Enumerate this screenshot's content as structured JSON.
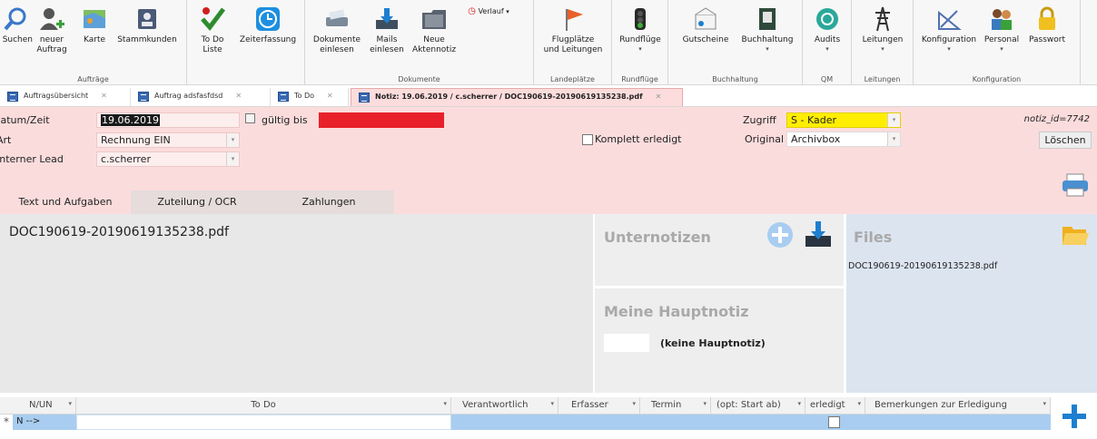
{
  "ribbon": {
    "groups": {
      "auftraege": "Aufträge",
      "dokumente": "Dokumente",
      "landeplaetze": "Landeplätze",
      "rundfluege": "Rundflüge",
      "buchhaltung": "Buchhaltung",
      "qm": "QM",
      "leitungen": "Leitungen",
      "konfiguration": "Konfiguration"
    },
    "buttons": {
      "suchen": "Suchen",
      "neuer_auftrag": "neuer\nAuftrag",
      "karte": "Karte",
      "stammkunden": "Stammkunden",
      "todo_liste": "To Do\nListe",
      "zeiterfassung": "Zeiterfassung",
      "verlauf": "Verlauf",
      "dokumente_einlesen": "Dokumente\neinlesen",
      "mails_einlesen": "Mails\neinlesen",
      "neue_aktennotiz": "Neue\nAktennotiz",
      "flugplaetze": "Flugplätze\nund Leitungen",
      "rundfluege": "Rundflüge",
      "gutscheine": "Gutscheine",
      "buchhaltung": "Buchhaltung",
      "audits": "Audits",
      "leitungen": "Leitungen",
      "konfiguration": "Konfiguration",
      "personal": "Personal",
      "passwort": "Passwort"
    }
  },
  "tabs": [
    {
      "label": "Auftragsübersicht"
    },
    {
      "label": "Auftrag adsfasfdsd"
    },
    {
      "label": "To Do"
    },
    {
      "label": "Notiz: 19.06.2019 / c.scherrer / DOC190619-20190619135238.pdf"
    }
  ],
  "form": {
    "datum_label": "Datum/Zeit",
    "datum_value": "19.06.2019",
    "gueltig_label": "gültig bis",
    "art_label": "Art",
    "art_value": "Rechnung EIN",
    "lead_label": "Interner Lead",
    "lead_value": "c.scherrer",
    "komplett_label": "Komplett erledigt",
    "zugriff_label": "Zugriff",
    "zugriff_value": "S - Kader",
    "original_label": "Original",
    "original_value": "Archivbox",
    "notiz_id": "notiz_id=7742",
    "loeschen": "Löschen"
  },
  "subtabs": [
    "Text und Aufgaben",
    "Zuteilung / OCR",
    "Zahlungen"
  ],
  "main": {
    "text_content": "DOC190619-20190619135238.pdf",
    "unternotizen_title": "Unternotizen",
    "hauptnotiz_title": "Meine Hauptnotiz",
    "hauptnotiz_value": "(keine Hauptnotiz)",
    "files_title": "Files",
    "files": [
      "DOC190619-20190619135238.pdf"
    ]
  },
  "grid": {
    "columns": [
      "N/UN",
      "To Do",
      "Verantwortlich",
      "Erfasser",
      "Termin",
      "(opt: Start ab)",
      "erledigt",
      "Bemerkungen zur Erledigung"
    ],
    "new_row": "N -->"
  },
  "colors": {
    "form_bg": "#fbdcdc",
    "red_field": "#e8202a",
    "yellow_field": "#ffee00",
    "grid_row_blue": "#a8cdf0"
  }
}
